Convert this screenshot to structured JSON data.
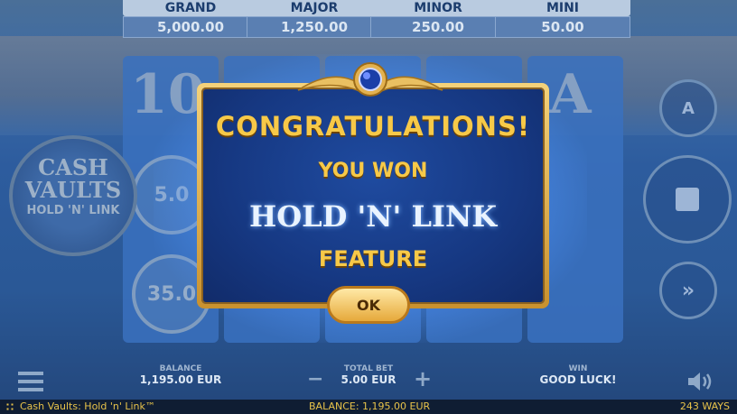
{
  "jackpots": [
    {
      "label": "GRAND",
      "value": "5,000.00"
    },
    {
      "label": "MAJOR",
      "value": "1,250.00"
    },
    {
      "label": "MINOR",
      "value": "250.00"
    },
    {
      "label": "MINI",
      "value": "50.00"
    }
  ],
  "reels": {
    "symbols": [
      "10",
      "A",
      "5.0",
      "35.0"
    ]
  },
  "logo": {
    "line1": "CASH",
    "line2": "VAULTS",
    "line3": "HOLD 'N' LINK"
  },
  "dialog": {
    "title": "CONGRATULATIONS!",
    "line2": "YOU WON",
    "feature_name": "HOLD 'N' LINK",
    "line4": "FEATURE",
    "ok_label": "OK"
  },
  "controls": {
    "autoplay_letter": "A",
    "menu_icon": "hamburger-icon",
    "sound_icon": "speaker-icon",
    "stop_icon": "stop-icon",
    "fast_icon": "double-chevron-icon"
  },
  "bottom": {
    "balance_label": "BALANCE",
    "balance_value": "1,195.00 EUR",
    "bet_label": "TOTAL BET",
    "bet_value": "5.00 EUR",
    "minus": "−",
    "plus": "+",
    "win_label": "WIN",
    "win_value": "GOOD LUCK!"
  },
  "status": {
    "game_title": "Cash Vaults: Hold 'n' Link™",
    "balance": "BALANCE: 1,195.00 EUR",
    "ways": "243 WAYS"
  }
}
